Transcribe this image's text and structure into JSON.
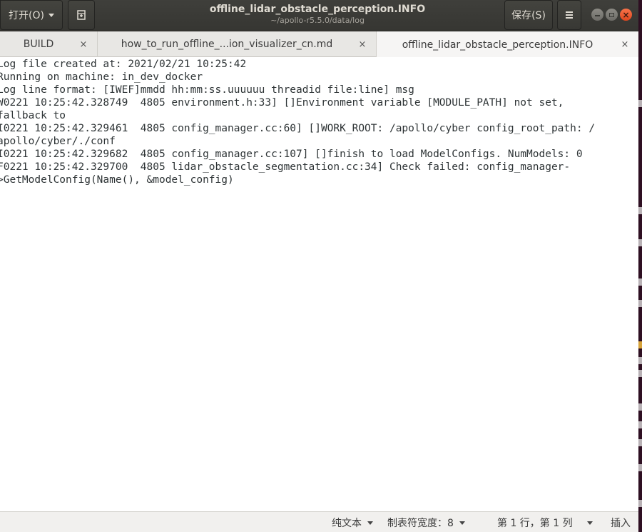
{
  "window": {
    "title": "offline_lidar_obstacle_perception.INFO",
    "subtitle": "~/apollo-r5.5.0/data/log"
  },
  "header": {
    "open_label": "打开(O)",
    "save_label": "保存(S)",
    "newtab_icon": "new-document-icon",
    "menu_icon": "hamburger-menu-icon"
  },
  "tabs": [
    {
      "label": "BUILD",
      "close": "×"
    },
    {
      "label": "how_to_run_offline_...ion_visualizer_cn.md",
      "close": "×"
    },
    {
      "label": "offline_lidar_obstacle_perception.INFO",
      "close": "×",
      "active": true
    }
  ],
  "editor": {
    "lines": [
      "Log file created at: 2021/02/21 10:25:42",
      "Running on machine: in_dev_docker",
      "Log line format: [IWEF]mmdd hh:mm:ss.uuuuuu threadid file:line] msg",
      "W0221 10:25:42.328749  4805 environment.h:33] []Environment variable [MODULE_PATH] not set,",
      "fallback to",
      "I0221 10:25:42.329461  4805 config_manager.cc:60] []WORK_ROOT: /apollo/cyber config_root_path: /",
      "apollo/cyber/./conf",
      "I0221 10:25:42.329682  4805 config_manager.cc:107] []finish to load ModelConfigs. NumModels: 0",
      "F0221 10:25:42.329700  4805 lidar_obstacle_segmentation.cc:34] Check failed: config_manager-",
      ">GetModelConfig(Name(), &model_config)"
    ]
  },
  "statusbar": {
    "language": "纯文本",
    "tab_width": "制表符宽度：8",
    "position": "第 1 行，第 1 列",
    "mode": "插入"
  },
  "colors": {
    "headerbar": "#3c3b37",
    "close_button": "#e95420",
    "background_terminal": "#2e0f22"
  }
}
